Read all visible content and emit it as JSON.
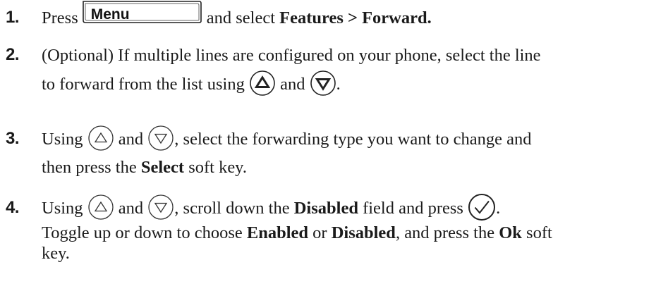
{
  "steps": [
    {
      "num": "1.",
      "t1": "Press",
      "menu_key": "Menu",
      "t2": "and select",
      "t3": "Features > Forward."
    },
    {
      "num": "2.",
      "t1": "(Optional) If multiple lines are configured on your phone, select the line",
      "t2": "to forward from the list using",
      "t3": "and",
      "t4": "."
    },
    {
      "num": "3.",
      "t1": "Using",
      "t2": "and",
      "t3": ", select the forwarding type you want to change and",
      "t4": "then press the",
      "t5": "Select",
      "t6": "soft key."
    },
    {
      "num": "4.",
      "t1": "Using",
      "t2": "and",
      "t3": ", scroll down the",
      "t4": "Disabled",
      "t5": "field and press",
      "t6": ".",
      "t7": "Toggle up or down to choose",
      "t8": "Enabled",
      "t9": "or",
      "t10": "Disabled",
      "t11": ", and press the",
      "t12": "Ok",
      "t13": "soft",
      "t14": "key."
    }
  ],
  "icons": {
    "menu_key": "menu-key-icon",
    "up_bold": "up-arrow-key-icon",
    "down_bold": "down-arrow-key-icon",
    "up_thin": "up-arrow-key-icon",
    "down_thin": "down-arrow-key-icon",
    "select": "select-checkmark-key-icon"
  }
}
